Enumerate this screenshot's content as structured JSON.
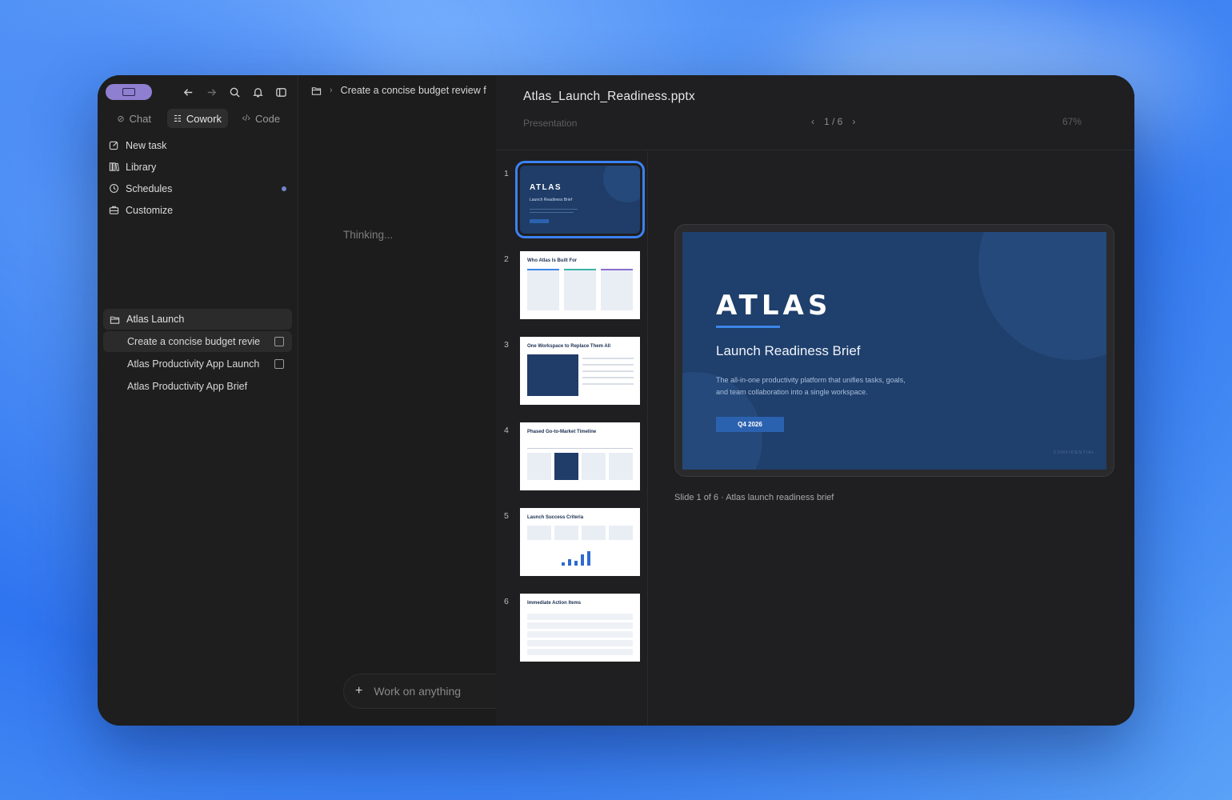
{
  "sidebar": {
    "modes": [
      {
        "label": "Chat",
        "icon": "chat-icon"
      },
      {
        "label": "Cowork",
        "icon": "cowork-icon"
      },
      {
        "label": "Code",
        "icon": "code-icon"
      }
    ],
    "nav": [
      {
        "label": "New task",
        "icon": "edit-icon"
      },
      {
        "label": "Library",
        "icon": "library-icon"
      },
      {
        "label": "Schedules",
        "icon": "clock-icon"
      },
      {
        "label": "Customize",
        "icon": "briefcase-icon"
      }
    ],
    "project": {
      "name": "Atlas Launch",
      "items": [
        {
          "label": "Create a concise budget revie"
        },
        {
          "label": "Atlas Productivity App Launch"
        },
        {
          "label": "Atlas Productivity App Brief"
        }
      ]
    }
  },
  "chat": {
    "breadcrumb": "Create a concise budget review f",
    "thinking": "Thinking...",
    "composer_placeholder": "Work on anything"
  },
  "preview": {
    "file_name": "Atlas_Launch_Readiness.pptx",
    "file_type": "Presentation",
    "page_indicator": "1 / 6",
    "zoom": "67%",
    "thumb_numbers": [
      "1",
      "2",
      "3",
      "4",
      "5",
      "6"
    ],
    "thumb_titles": [
      "ATLAS",
      "Who Atlas Is Built For",
      "One Workspace to Replace Them All",
      "Phased Go-to-Market Timeline",
      "Launch Success Criteria",
      "Immediate Action Items"
    ],
    "thumb_1_subtitle": "Launch Readiness Brief",
    "slide": {
      "brand": "ATLAS",
      "heading": "Launch Readiness Brief",
      "body": "The all-in-one productivity platform that unifies tasks, goals, and team collaboration into a single workspace.",
      "badge": "Q4 2026",
      "footer": "CONFIDENTIAL"
    },
    "caption": "Slide 1 of 6 · Atlas launch readiness brief"
  }
}
